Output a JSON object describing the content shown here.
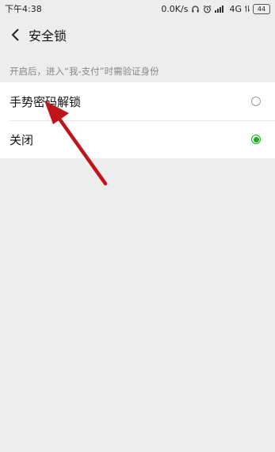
{
  "status_bar": {
    "time": "下午4:38",
    "speed": "0.0K/s",
    "network": "4G",
    "battery": "44"
  },
  "nav": {
    "title": "安全锁"
  },
  "hint": "开启后，进入“我-支付”时需验证身份",
  "options": [
    {
      "label": "手势密码解锁",
      "selected": false
    },
    {
      "label": "关闭",
      "selected": true
    }
  ],
  "colors": {
    "accent_green": "#1aad19",
    "annotation_red": "#c0141b",
    "background": "#ededed"
  }
}
